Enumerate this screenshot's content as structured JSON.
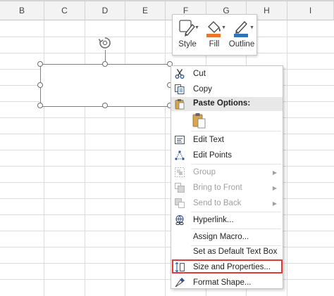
{
  "sheet": {
    "columns": [
      "B",
      "C",
      "D",
      "E",
      "F",
      "G",
      "H",
      "I"
    ]
  },
  "mini_toolbar": {
    "style_label": "Style",
    "fill_label": "Fill",
    "outline_label": "Outline",
    "colors": {
      "fill": "#e8762c",
      "outline": "#2e75b6"
    }
  },
  "context_menu": {
    "cut": "Cut",
    "copy": "Copy",
    "paste_options": "Paste Options:",
    "edit_text": "Edit Text",
    "edit_points": "Edit Points",
    "group": "Group",
    "bring_to_front": "Bring to Front",
    "send_to_back": "Send to Back",
    "hyperlink": "Hyperlink...",
    "assign_macro": "Assign Macro...",
    "set_default_text_box": "Set as Default Text Box",
    "size_and_properties": "Size and Properties...",
    "format_shape": "Format Shape..."
  },
  "colors": {
    "highlight": "#e23a3a"
  }
}
